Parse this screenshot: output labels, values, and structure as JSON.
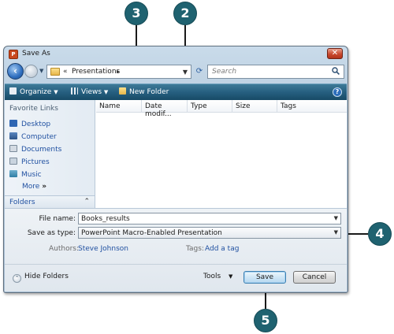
{
  "window": {
    "title": "Save As",
    "app_icon": "powerpoint-file-icon",
    "close_glyph": "✕"
  },
  "address": {
    "crumb_prefix": "«",
    "path": "Presentations",
    "path_arrow": "▸",
    "dropdown": "▼",
    "search_placeholder": "Search"
  },
  "toolbar": {
    "organize": "Organize",
    "views": "Views",
    "new_folder": "New Folder",
    "dropdown": "▼",
    "help": "?"
  },
  "nav": {
    "header": "Favorite Links",
    "items": [
      {
        "label": "Desktop",
        "icon": "desktop-icon"
      },
      {
        "label": "Computer",
        "icon": "computer-icon"
      },
      {
        "label": "Documents",
        "icon": "documents-icon"
      },
      {
        "label": "Pictures",
        "icon": "pictures-icon"
      },
      {
        "label": "Music",
        "icon": "music-icon"
      }
    ],
    "more": "More",
    "more_glyph": "»",
    "folders": "Folders",
    "folders_chevron": "⌃"
  },
  "columns": [
    "Name",
    "Date modif...",
    "Type",
    "Size",
    "Tags"
  ],
  "form": {
    "file_name_label": "File name:",
    "file_name_value": "Books_results",
    "save_type_label": "Save as type:",
    "save_type_value": "PowerPoint Macro-Enabled Presentation",
    "authors_label": "Authors:",
    "authors_value": "Steve Johnson",
    "tags_label": "Tags:",
    "tags_value": "Add a tag",
    "dropdown": "▼"
  },
  "footer": {
    "hide_folders": "Hide Folders",
    "hide_glyph": "⌃",
    "tools": "Tools",
    "tools_drop": "▼",
    "save": "Save",
    "cancel": "Cancel"
  },
  "callouts": {
    "c2": "2",
    "c3": "3",
    "c4": "4",
    "c5": "5"
  },
  "colors": {
    "callout": "#1f6270",
    "toolbar": "#265f80",
    "link": "#2151a1"
  }
}
